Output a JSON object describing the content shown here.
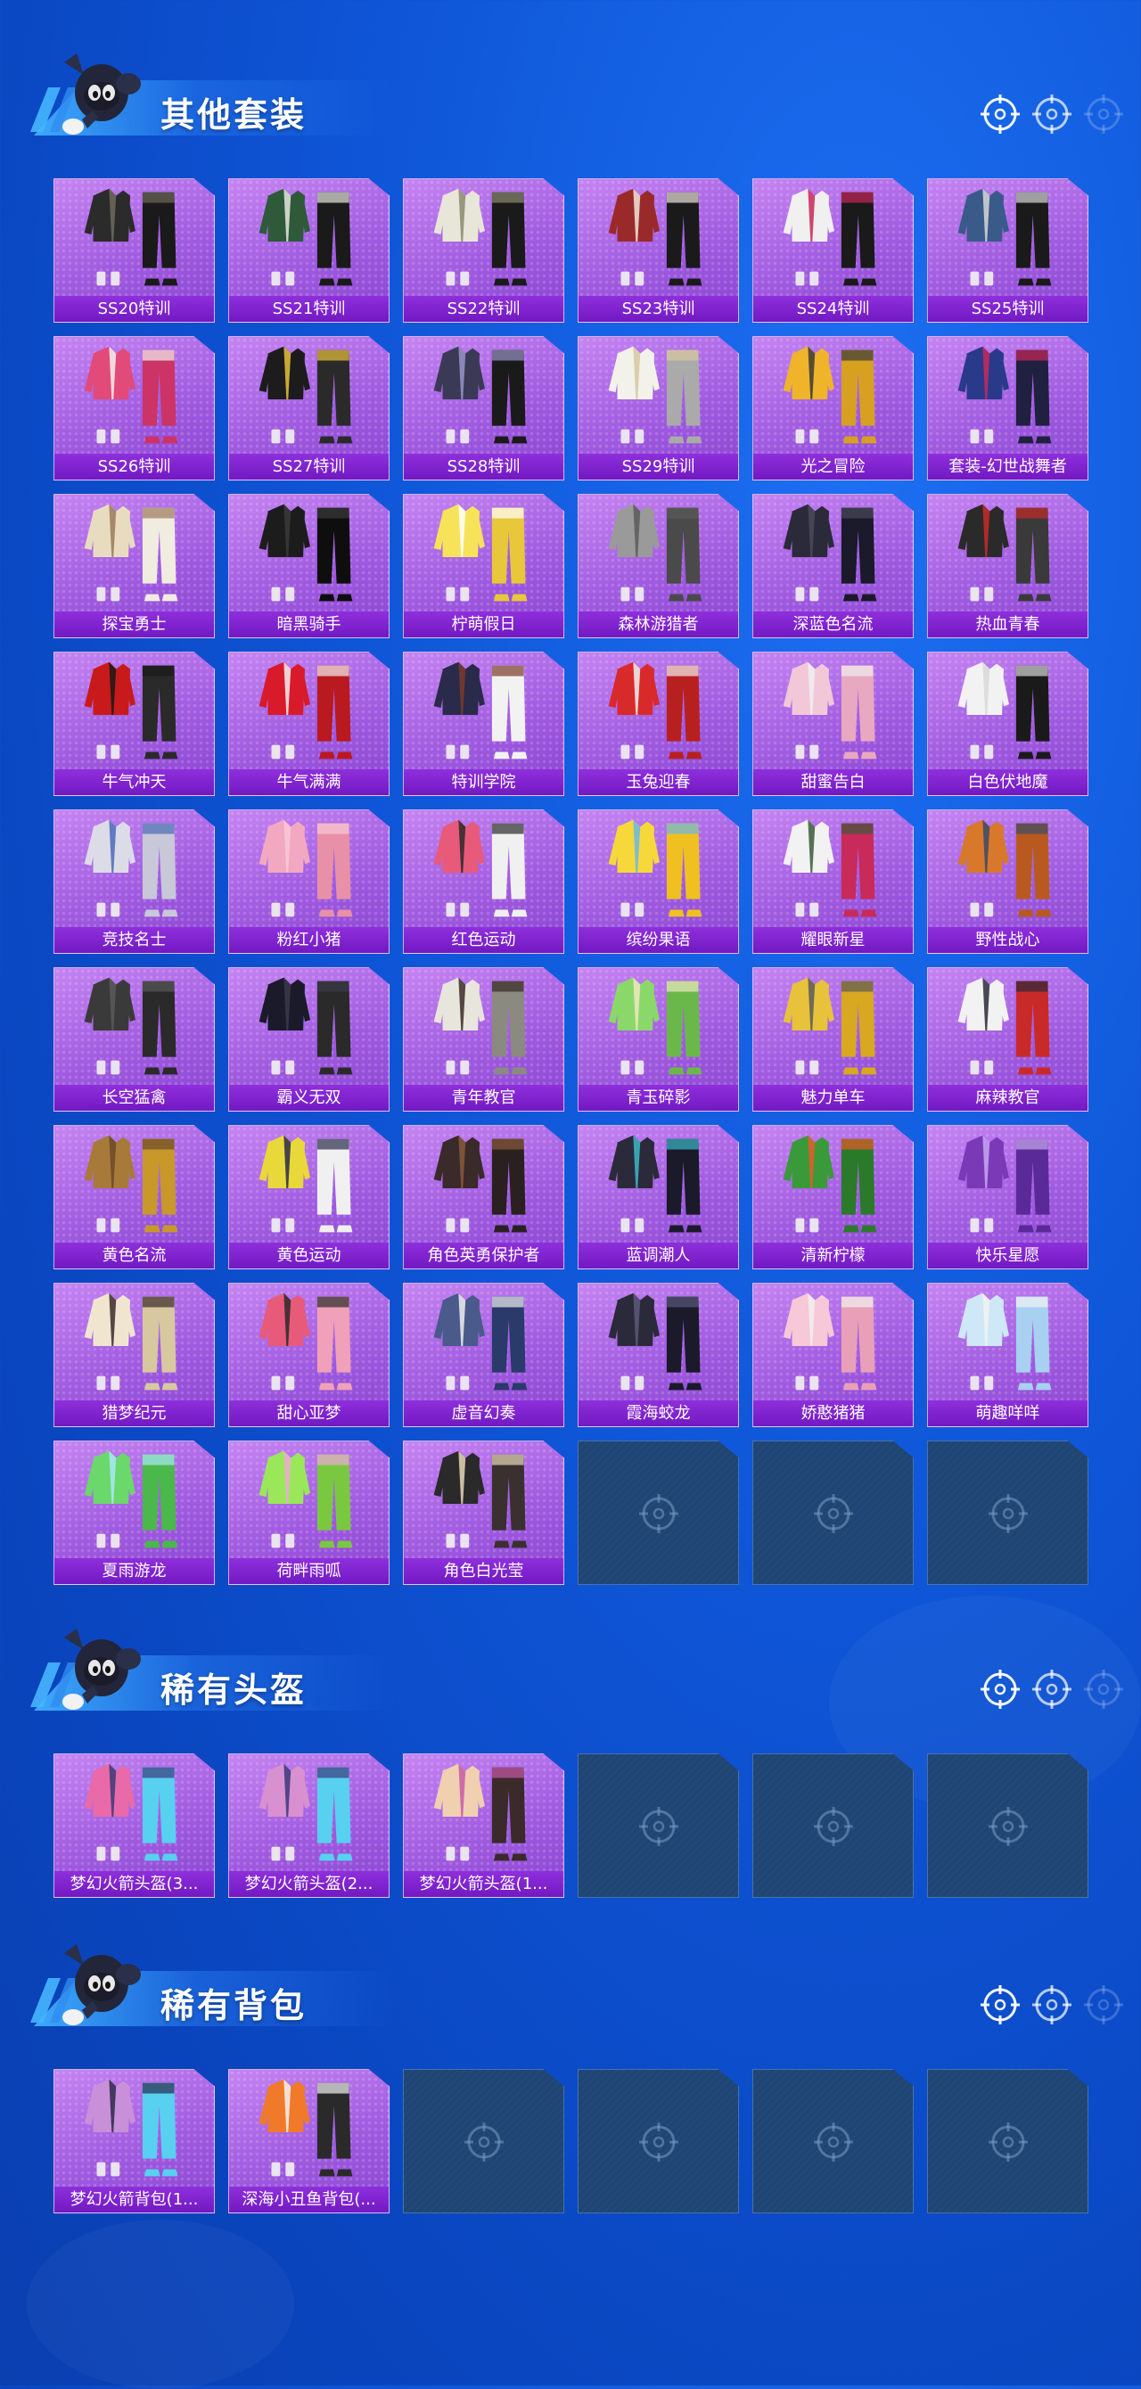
{
  "sections": [
    {
      "title": "其他套装",
      "empty_slots": 3,
      "items": [
        {
          "label": "SS20特训",
          "palette": [
            "#2b2b2b",
            "#6e6a5a",
            "#1a1a1a"
          ]
        },
        {
          "label": "SS21特训",
          "palette": [
            "#2f5a3a",
            "#e8e8e0",
            "#1a1a1a"
          ]
        },
        {
          "label": "SS22特训",
          "palette": [
            "#e8e6d8",
            "#8a8a70",
            "#1a1a1a"
          ]
        },
        {
          "label": "SS23特训",
          "palette": [
            "#9a2a2a",
            "#efe6dc",
            "#1a1a1a"
          ]
        },
        {
          "label": "SS24特训",
          "palette": [
            "#f0f0f0",
            "#c8285a",
            "#1a1a1a"
          ]
        },
        {
          "label": "SS25特训",
          "palette": [
            "#3a5a8a",
            "#d8d8d8",
            "#1a1a1a"
          ]
        },
        {
          "label": "SS26特训",
          "palette": [
            "#e24a7a",
            "#f2f2f2",
            "#cc3366"
          ]
        },
        {
          "label": "SS27特训",
          "palette": [
            "#1c1c1c",
            "#e8c23a",
            "#2a2a2a"
          ]
        },
        {
          "label": "SS28特训",
          "palette": [
            "#3a3a56",
            "#9a94c8",
            "#1a1a1a"
          ]
        },
        {
          "label": "SS29特训",
          "palette": [
            "#f2f2ea",
            "#d8c8a0",
            "#aaaaaa"
          ]
        },
        {
          "label": "光之冒险",
          "palette": [
            "#f0b42a",
            "#3a3a3a",
            "#d8a020"
          ]
        },
        {
          "label": "套装-幻世战舞者",
          "palette": [
            "#2a3a8a",
            "#c82a5a",
            "#202040"
          ]
        },
        {
          "label": "探宝勇士",
          "palette": [
            "#e8dcc0",
            "#9a7a5a",
            "#f0ece0"
          ]
        },
        {
          "label": "暗黑骑手",
          "palette": [
            "#1c1c1c",
            "#3a3a3a",
            "#0e0e0e"
          ]
        },
        {
          "label": "柠萌假日",
          "palette": [
            "#f6e35a",
            "#ffffff",
            "#e8c83a"
          ]
        },
        {
          "label": "森林游猎者",
          "palette": [
            "#9a9a9a",
            "#5a5a5a",
            "#4a4a4a"
          ]
        },
        {
          "label": "深蓝色名流",
          "palette": [
            "#2a2a3a",
            "#4a4a5a",
            "#1a1a2a"
          ]
        },
        {
          "label": "热血青春",
          "palette": [
            "#2a2a2a",
            "#c82a2a",
            "#3a3a3a"
          ]
        },
        {
          "label": "牛气冲天",
          "palette": [
            "#c81a1a",
            "#1a1a1a",
            "#2a2a2a"
          ]
        },
        {
          "label": "牛气满满",
          "palette": [
            "#d81a2a",
            "#f2f2f2",
            "#b81a20"
          ]
        },
        {
          "label": "特训学院",
          "palette": [
            "#2a2a4a",
            "#7a3a2a",
            "#f2f2f2"
          ]
        },
        {
          "label": "玉兔迎春",
          "palette": [
            "#d82a2a",
            "#f2f2f2",
            "#b82020"
          ]
        },
        {
          "label": "甜蜜告白",
          "palette": [
            "#f2c8d8",
            "#f0f0f0",
            "#e8a8c0"
          ]
        },
        {
          "label": "白色伏地魔",
          "palette": [
            "#f2f2f2",
            "#d8d8d8",
            "#1a1a1a"
          ]
        },
        {
          "label": "竞技名士",
          "palette": [
            "#dcdce8",
            "#4a6ab8",
            "#c8c8d8"
          ]
        },
        {
          "label": "粉红小猪",
          "palette": [
            "#f2a8c0",
            "#f8c8d8",
            "#e890a8"
          ]
        },
        {
          "label": "红色运动",
          "palette": [
            "#e85a7a",
            "#2a2a2a",
            "#f0f0f0"
          ]
        },
        {
          "label": "缤纷果语",
          "palette": [
            "#f6d83a",
            "#6ab8e8",
            "#f0c020"
          ]
        },
        {
          "label": "耀眼新星",
          "palette": [
            "#f2f2f2",
            "#3a5a3a",
            "#c82a5a"
          ]
        },
        {
          "label": "野性战心",
          "palette": [
            "#d8782a",
            "#3a4a6a",
            "#b85a20"
          ]
        },
        {
          "label": "长空猛禽",
          "palette": [
            "#3a3a3a",
            "#5a5a5a",
            "#2a2a2a"
          ]
        },
        {
          "label": "霸义无双",
          "palette": [
            "#1a1a2a",
            "#3a3a4a",
            "#2a2a2a"
          ]
        },
        {
          "label": "青年教官",
          "palette": [
            "#e8e6dc",
            "#3a2a2a",
            "#8a8a80"
          ]
        },
        {
          "label": "青玉碎影",
          "palette": [
            "#8ad86a",
            "#f0e8c0",
            "#6ab84a"
          ]
        },
        {
          "label": "魅力单车",
          "palette": [
            "#e8c23a",
            "#5a5a5a",
            "#d8a820"
          ]
        },
        {
          "label": "麻辣教官",
          "palette": [
            "#f2f2f2",
            "#2a2a3a",
            "#c82a2a"
          ]
        },
        {
          "label": "黄色名流",
          "palette": [
            "#a87a3a",
            "#6a4a2a",
            "#c8982a"
          ]
        },
        {
          "label": "黄色运动",
          "palette": [
            "#e8d83a",
            "#2a2a4a",
            "#f0f0f0"
          ]
        },
        {
          "label": "角色英勇保护者",
          "palette": [
            "#3a2a2a",
            "#8a5a3a",
            "#2a2020"
          ]
        },
        {
          "label": "蓝调潮人",
          "palette": [
            "#2a2a3a",
            "#3ab8c8",
            "#1a1a2a"
          ]
        },
        {
          "label": "清新柠檬",
          "palette": [
            "#3a9a3a",
            "#e85a2a",
            "#2a7a2a"
          ]
        },
        {
          "label": "快乐星愿",
          "palette": [
            "#7a3ab8",
            "#c8a8f0",
            "#5a2a98"
          ]
        },
        {
          "label": "猎梦纪元",
          "palette": [
            "#f0e6d0",
            "#3a2a2a",
            "#d8c8a0"
          ]
        },
        {
          "label": "甜心亚梦",
          "palette": [
            "#e85a7a",
            "#2a2a2a",
            "#f0a0b8"
          ]
        },
        {
          "label": "虚音幻奏",
          "palette": [
            "#4a5a8a",
            "#f0f0f0",
            "#2a3a6a"
          ]
        },
        {
          "label": "霞海蛟龙",
          "palette": [
            "#2a2a3a",
            "#5a5a7a",
            "#1a1a2a"
          ]
        },
        {
          "label": "娇憨猪猪",
          "palette": [
            "#f6c8d8",
            "#f0f0f0",
            "#e8a0b8"
          ]
        },
        {
          "label": "萌趣咩咩",
          "palette": [
            "#cfe8f8",
            "#f2f2f2",
            "#a8d0f0"
          ]
        },
        {
          "label": "夏雨游龙",
          "palette": [
            "#6ad86a",
            "#a8e8f8",
            "#4ab84a"
          ]
        },
        {
          "label": "荷畔雨呱",
          "palette": [
            "#9ae85a",
            "#f0a8d8",
            "#7ac840"
          ]
        },
        {
          "label": "角色白光莹",
          "palette": [
            "#2a2a2a",
            "#e8d8b8",
            "#3a3030"
          ]
        }
      ]
    },
    {
      "title": "稀有头盔",
      "empty_slots": 3,
      "items": [
        {
          "label": "梦幻火箭头盔(3...",
          "palette": [
            "#e86aa8",
            "#3a3a7a",
            "#58d0f0"
          ]
        },
        {
          "label": "梦幻火箭头盔(2...",
          "palette": [
            "#d890d0",
            "#3a3a7a",
            "#58d0f0"
          ]
        },
        {
          "label": "梦幻火箭头盔(1...",
          "palette": [
            "#f0d0b0",
            "#c85aa8",
            "#3a2a2a"
          ]
        }
      ]
    },
    {
      "title": "稀有背包",
      "empty_slots": 4,
      "items": [
        {
          "label": "梦幻火箭背包(1...",
          "palette": [
            "#c890d8",
            "#2a2a4a",
            "#58d0f0"
          ]
        },
        {
          "label": "深海小丑鱼背包(...",
          "palette": [
            "#f07a2a",
            "#f2f2f2",
            "#2a2a2a"
          ]
        }
      ]
    }
  ]
}
